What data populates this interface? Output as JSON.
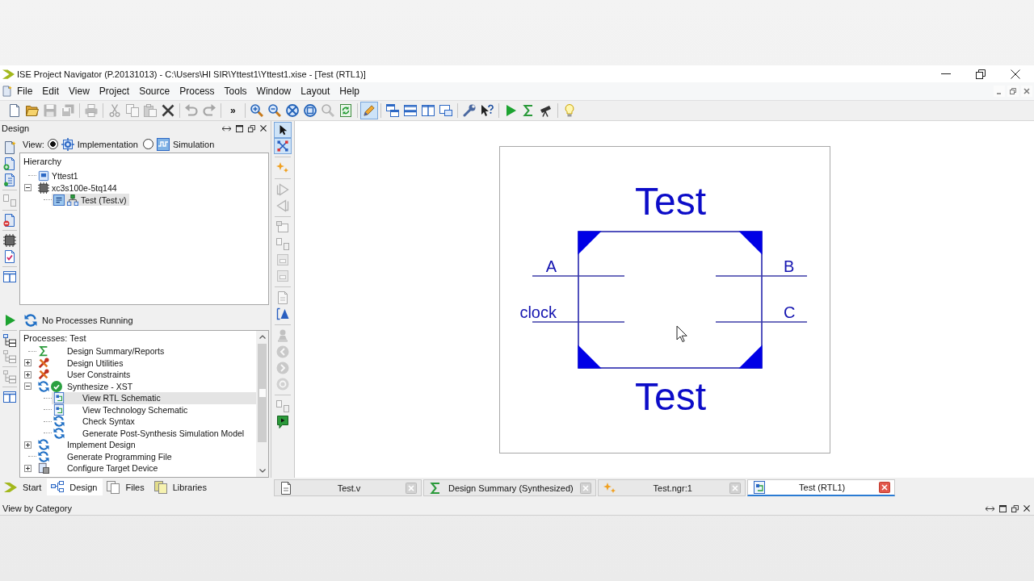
{
  "window": {
    "title": "ISE Project Navigator (P.20131013) - C:\\Users\\HI SIR\\Yttest1\\Yttest1.xise - [Test (RTL1)]"
  },
  "menu": [
    "File",
    "Edit",
    "View",
    "Project",
    "Source",
    "Process",
    "Tools",
    "Window",
    "Layout",
    "Help"
  ],
  "toolbar": [
    [
      {
        "kind": "icon",
        "disabled": false,
        "pressed": false
      },
      {
        "kind": "icon",
        "disabled": false,
        "pressed": false
      },
      {
        "kind": "icon",
        "disabled": true,
        "pressed": false
      },
      {
        "kind": "icon",
        "disabled": true,
        "pressed": false
      }
    ],
    [
      {
        "kind": "icon",
        "disabled": true,
        "pressed": false
      }
    ],
    [
      {
        "kind": "icon",
        "disabled": true,
        "pressed": false
      },
      {
        "kind": "icon",
        "disabled": true,
        "pressed": false
      },
      {
        "kind": "icon",
        "disabled": true,
        "pressed": false
      },
      {
        "kind": "icon",
        "disabled": false,
        "pressed": false
      }
    ],
    [
      {
        "kind": "icon",
        "disabled": true,
        "pressed": false
      },
      {
        "kind": "icon",
        "disabled": true,
        "pressed": false
      }
    ],
    [
      {
        "kind": "overflow",
        "label": "»"
      }
    ],
    [
      {
        "kind": "icon",
        "disabled": false,
        "pressed": false
      },
      {
        "kind": "icon",
        "disabled": false,
        "pressed": false
      },
      {
        "kind": "icon",
        "disabled": false,
        "pressed": false
      },
      {
        "kind": "icon",
        "disabled": false,
        "pressed": false
      },
      {
        "kind": "icon",
        "disabled": true,
        "pressed": false
      },
      {
        "kind": "icon",
        "disabled": false,
        "pressed": false
      }
    ],
    [
      {
        "kind": "icon",
        "disabled": false,
        "pressed": true
      }
    ],
    [
      {
        "kind": "icon",
        "disabled": false,
        "pressed": false
      },
      {
        "kind": "icon",
        "disabled": false,
        "pressed": false
      },
      {
        "kind": "icon",
        "disabled": false,
        "pressed": false
      },
      {
        "kind": "icon",
        "disabled": false,
        "pressed": false
      }
    ],
    [
      {
        "kind": "icon",
        "disabled": false,
        "pressed": false
      },
      {
        "kind": "icon",
        "disabled": false,
        "pressed": false
      }
    ],
    [
      {
        "kind": "icon",
        "disabled": false,
        "pressed": false
      },
      {
        "kind": "icon",
        "disabled": false,
        "pressed": false
      },
      {
        "kind": "icon",
        "disabled": false,
        "pressed": false
      }
    ],
    [
      {
        "kind": "icon",
        "disabled": false,
        "pressed": false
      }
    ]
  ],
  "design_panel": {
    "title": "Design",
    "side_toolbar": [
      [
        {
          "disabled": false
        },
        {
          "disabled": false
        },
        {
          "disabled": false
        }
      ],
      [
        {
          "disabled": true
        }
      ],
      [
        {
          "disabled": false
        }
      ],
      [
        {
          "disabled": false
        },
        {
          "disabled": false
        }
      ],
      [
        {
          "disabled": false
        }
      ]
    ],
    "view": {
      "label": "View:",
      "options": [
        {
          "label": "Implementation",
          "selected": true
        },
        {
          "label": "Simulation",
          "selected": false
        }
      ]
    },
    "hierarchy": {
      "title": "Hierarchy",
      "items": [
        {
          "kind": "project",
          "label": "Yttest1",
          "selected": false
        },
        {
          "kind": "device",
          "label": "xc3s100e-5tq144",
          "selected": false,
          "expanded": true,
          "children": [
            {
              "kind": "module",
              "label": "Test (Test.v)",
              "selected": true
            }
          ]
        }
      ]
    }
  },
  "processes_panel": {
    "side_toolbar": [
      [
        {
          "disabled": false
        }
      ],
      [
        {
          "disabled": false
        },
        {
          "disabled": true
        }
      ],
      [
        {
          "disabled": true
        }
      ],
      [
        {
          "disabled": false
        }
      ]
    ],
    "status": "No Processes Running",
    "title": "Processes: Test",
    "items": [
      {
        "kind": "report",
        "label": "Design Summary/Reports",
        "selected": false,
        "done": false
      },
      {
        "kind": "tool",
        "label": "Design Utilities",
        "selected": false,
        "done": false,
        "expanded": false
      },
      {
        "kind": "tool",
        "label": "User Constraints",
        "selected": false,
        "done": false,
        "expanded": false
      },
      {
        "kind": "process",
        "label": "Synthesize - XST",
        "selected": false,
        "done": true,
        "expanded": true,
        "children": [
          {
            "kind": "schematic",
            "label": "View RTL Schematic",
            "selected": true,
            "done": false
          },
          {
            "kind": "schematic",
            "label": "View Technology Schematic",
            "selected": false,
            "done": false
          },
          {
            "kind": "process",
            "label": "Check Syntax",
            "selected": false,
            "done": false
          },
          {
            "kind": "process",
            "label": "Generate Post-Synthesis Simulation Model",
            "selected": false,
            "done": false
          }
        ]
      },
      {
        "kind": "process",
        "label": "Implement Design",
        "selected": false,
        "done": false,
        "expanded": false
      },
      {
        "kind": "process",
        "label": "Generate Programming File",
        "selected": false,
        "done": false
      },
      {
        "kind": "configure",
        "label": "Configure Target Device",
        "selected": false,
        "done": false,
        "expanded": false
      }
    ]
  },
  "schematic_toolbar": [
    [
      {
        "disabled": false,
        "pressed": true
      },
      {
        "disabled": false,
        "pressed": true
      }
    ],
    [
      {
        "disabled": false,
        "pressed": false
      }
    ],
    [
      {
        "disabled": true,
        "pressed": false
      },
      {
        "disabled": true,
        "pressed": false
      }
    ],
    [
      {
        "disabled": true,
        "pressed": false
      },
      {
        "disabled": true,
        "pressed": false
      },
      {
        "disabled": true,
        "pressed": false
      },
      {
        "disabled": true,
        "pressed": false
      }
    ],
    [
      {
        "disabled": true,
        "pressed": false
      },
      {
        "disabled": false,
        "pressed": false
      }
    ],
    [
      {
        "disabled": true,
        "pressed": false
      },
      {
        "disabled": true,
        "pressed": false
      },
      {
        "disabled": true,
        "pressed": false
      },
      {
        "disabled": true,
        "pressed": false
      }
    ],
    [
      {
        "disabled": true,
        "pressed": false
      },
      {
        "disabled": false,
        "pressed": false
      }
    ]
  ],
  "schematic": {
    "top_label": "Test",
    "bottom_label": "Test",
    "inputs": [
      "A",
      "clock"
    ],
    "outputs": [
      "B",
      "C"
    ]
  },
  "panel_tabs": [
    {
      "label": "Start",
      "selected": false
    },
    {
      "label": "Design",
      "selected": true
    },
    {
      "label": "Files",
      "selected": false
    },
    {
      "label": "Libraries",
      "selected": false
    }
  ],
  "document_tabs": [
    {
      "label": "Test.v",
      "selected": false
    },
    {
      "label": "Design Summary (Synthesized)",
      "selected": false
    },
    {
      "label": "Test.ngr:1",
      "selected": false
    },
    {
      "label": "Test (RTL1)",
      "selected": true
    }
  ],
  "status_bar": {
    "text": "View by Category"
  }
}
